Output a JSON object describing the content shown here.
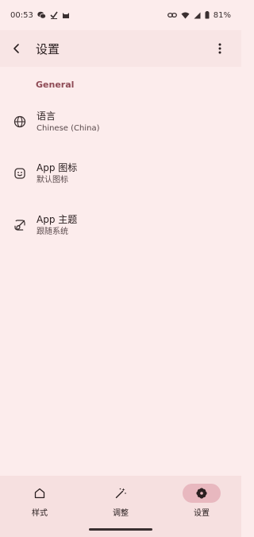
{
  "status_bar": {
    "time": "00:53",
    "battery": "81%",
    "left_icons": [
      "wechat-icon",
      "check-icon",
      "cat-icon"
    ],
    "right_icons": [
      "link-icon",
      "wifi-icon",
      "signal-icon",
      "battery-icon"
    ]
  },
  "app_bar": {
    "title": "设置"
  },
  "section": {
    "header": "General"
  },
  "settings": [
    {
      "title": "语言",
      "subtitle": "Chinese (China)",
      "icon": "globe-icon"
    },
    {
      "title": "App 图标",
      "subtitle": "默认图标",
      "icon": "app-icon"
    },
    {
      "title": "App 主题",
      "subtitle": "跟随系统",
      "icon": "brush-icon"
    }
  ],
  "nav": {
    "items": [
      {
        "label": "样式",
        "icon": "home-icon",
        "active": false
      },
      {
        "label": "调整",
        "icon": "magic-wand-icon",
        "active": false
      },
      {
        "label": "设置",
        "icon": "flower-settings-icon",
        "active": true
      }
    ]
  },
  "colors": {
    "background": "#fcecec",
    "app_bar": "#f8e5e5",
    "accent": "#8e4a55",
    "nav_active_pill": "#e8b8bf"
  }
}
